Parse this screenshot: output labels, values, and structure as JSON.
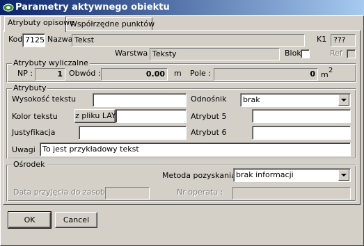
{
  "window": {
    "title": "Parametry aktywnego obiektu"
  },
  "tabs": [
    {
      "label": "Atrybuty opisowe",
      "active": true
    },
    {
      "label": "Współrzędne punktów",
      "active": false
    }
  ],
  "top": {
    "kod_label": "Kod",
    "kod_value": "7125",
    "nazwa_label": "Nazwa",
    "nazwa_value": "Tekst",
    "k1_label": "K1",
    "k1_value": "???",
    "warstwa_label": "Warstwa :",
    "warstwa_value": "Teksty",
    "blok_label": "Blok",
    "ref_label": "Ref"
  },
  "computed": {
    "title": "Atrybuty wyliczalne",
    "np_label": "NP :",
    "np_value": "1",
    "obwod_label": "Obwód :",
    "obwod_value": "0.00",
    "obwod_unit": "m",
    "pole_label": "Pole :",
    "pole_value": "0",
    "pole_unit": "m",
    "pole_unit_sup": "2"
  },
  "attributes": {
    "title": "Atrybuty",
    "wysokosc_label": "Wysokość tekstu",
    "wysokosc_value": "",
    "odnosnik_label": "Odnośnik",
    "odnosnik_value": "brak",
    "kolor_label": "Kolor tekstu",
    "kolor_button": "z pliku LAY",
    "kolor_value": "",
    "atrybut5_label": "Atrybut 5",
    "atrybut5_value": "",
    "justyfikacja_label": "Justyfikacja",
    "justyfikacja_value": "",
    "atrybut6_label": "Atrybut 6",
    "atrybut6_value": "",
    "uwagi_label": "Uwagi",
    "uwagi_value": "To jest przykładowy tekst"
  },
  "osrodek": {
    "title": "Ośrodek",
    "metoda_label": "Metoda pozyskania :",
    "metoda_value": "brak informacji",
    "data_label": "Data przyjęcia do zasobu :",
    "data_value": "",
    "nr_label": "Nr operatu :",
    "nr_value": ""
  },
  "buttons": {
    "ok": "OK",
    "cancel": "Cancel"
  }
}
